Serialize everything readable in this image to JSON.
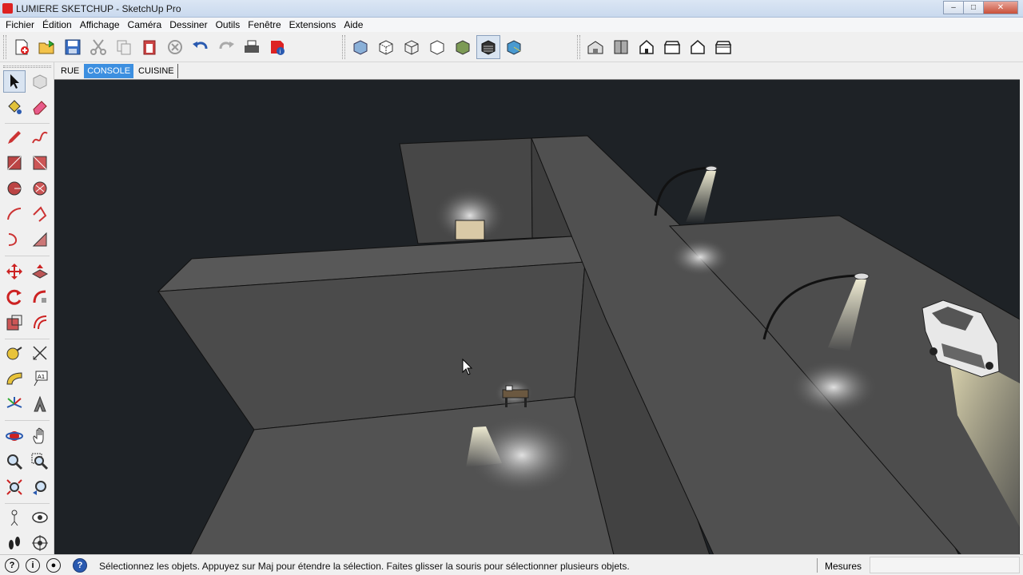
{
  "window": {
    "title": "LUMIERE SKETCHUP - SketchUp Pro",
    "minimize": "–",
    "maximize": "□",
    "close": "✕"
  },
  "menu": [
    "Fichier",
    "Édition",
    "Affichage",
    "Caméra",
    "Dessiner",
    "Outils",
    "Fenêtre",
    "Extensions",
    "Aide"
  ],
  "toolbar": {
    "groups": [
      {
        "tools": [
          "new-icon",
          "open-icon",
          "save-icon",
          "cut-icon",
          "copy-icon",
          "paste-icon",
          "erase-icon",
          "undo-icon",
          "redo-icon",
          "print-icon",
          "model-info-icon"
        ]
      },
      {
        "tools": [
          "xray-icon",
          "back-edges-icon",
          "wireframe-icon",
          "hidden-line-icon",
          "shaded-icon",
          "shaded-textures-icon",
          "monochrome-icon"
        ],
        "active": "shaded-textures-icon"
      },
      {
        "tools": [
          "iso-view-icon",
          "top-view-icon",
          "front-view-icon",
          "right-view-icon",
          "back-view-icon",
          "left-view-icon"
        ]
      }
    ]
  },
  "palette": {
    "tools": [
      "select-icon",
      "component-icon",
      "paint-bucket-icon",
      "eraser-icon",
      "pencil-icon",
      "freehand-icon",
      "rectangle-icon",
      "rotated-rectangle-icon",
      "circle-icon",
      "polygon-icon",
      "arc-icon",
      "two-point-arc-icon",
      "three-point-arc-icon",
      "pie-icon",
      "move-icon",
      "push-pull-icon",
      "rotate-icon",
      "follow-me-icon",
      "scale-icon",
      "offset-icon",
      "tape-measure-icon",
      "dimension-icon",
      "protractor-icon",
      "text-icon",
      "axes-icon",
      "3d-text-icon",
      "orbit-icon",
      "pan-icon",
      "zoom-icon",
      "zoom-window-icon",
      "zoom-extents-icon",
      "previous-view-icon",
      "position-camera-icon",
      "look-around-icon",
      "walk-icon",
      "section-plane-icon"
    ],
    "selected": "select-icon"
  },
  "scenes": {
    "tabs": [
      "RUE",
      "CONSOLE",
      "CUISINE"
    ],
    "active": "CONSOLE"
  },
  "status": {
    "message": "Sélectionnez les objets. Appuyez sur Maj pour étendre la sélection. Faites glisser la souris pour sélectionner plusieurs objets.",
    "measures_label": "Mesures",
    "measures_value": ""
  }
}
